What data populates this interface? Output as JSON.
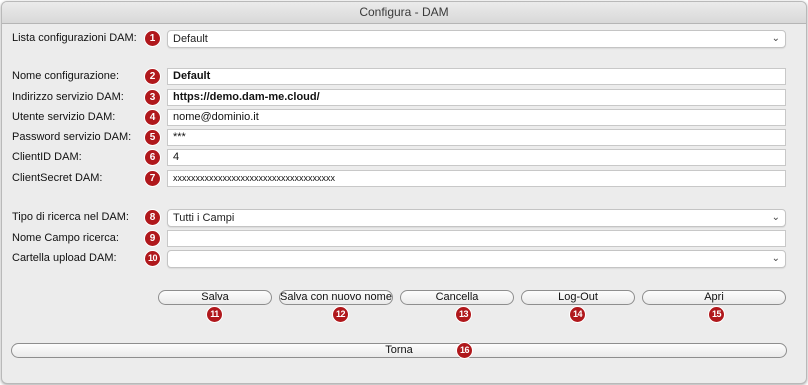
{
  "window": {
    "title": "Configura - DAM"
  },
  "form": {
    "lista": {
      "label": "Lista configurazioni DAM:",
      "value": "Default",
      "badge": "1"
    },
    "nome": {
      "label": "Nome configurazione:",
      "value": "Default",
      "badge": "2"
    },
    "indirizzo": {
      "label": "Indirizzo servizio DAM:",
      "value": "https://demo.dam-me.cloud/",
      "badge": "3"
    },
    "utente": {
      "label": "Utente servizio DAM:",
      "value": "nome@dominio.it",
      "badge": "4"
    },
    "password": {
      "label": "Password servizio DAM:",
      "value": "***",
      "badge": "5"
    },
    "clientid": {
      "label": "ClientID DAM:",
      "value": "4",
      "badge": "6"
    },
    "clientsecret": {
      "label": "ClientSecret DAM:",
      "value": "xxxxxxxxxxxxxxxxxxxxxxxxxxxxxxxxxxxx",
      "badge": "7"
    },
    "tipo_ricerca": {
      "label": "Tipo di ricerca nel DAM:",
      "value": "Tutti i Campi",
      "badge": "8"
    },
    "nome_campo": {
      "label": "Nome Campo ricerca:",
      "value": "",
      "badge": "9"
    },
    "cartella": {
      "label": "Cartella upload DAM:",
      "value": "",
      "badge": "10"
    }
  },
  "buttons": {
    "salva": {
      "label": "Salva",
      "badge": "11"
    },
    "salva_nuovo": {
      "label": "Salva con nuovo nome",
      "badge": "12"
    },
    "cancella": {
      "label": "Cancella",
      "badge": "13"
    },
    "logout": {
      "label": "Log-Out",
      "badge": "14"
    },
    "apri": {
      "label": "Apri",
      "badge": "15"
    },
    "torna": {
      "label": "Torna",
      "badge": "16"
    }
  },
  "icons": {
    "dropdown": "chevron-down-icon",
    "badge_color": "#b0181c"
  }
}
